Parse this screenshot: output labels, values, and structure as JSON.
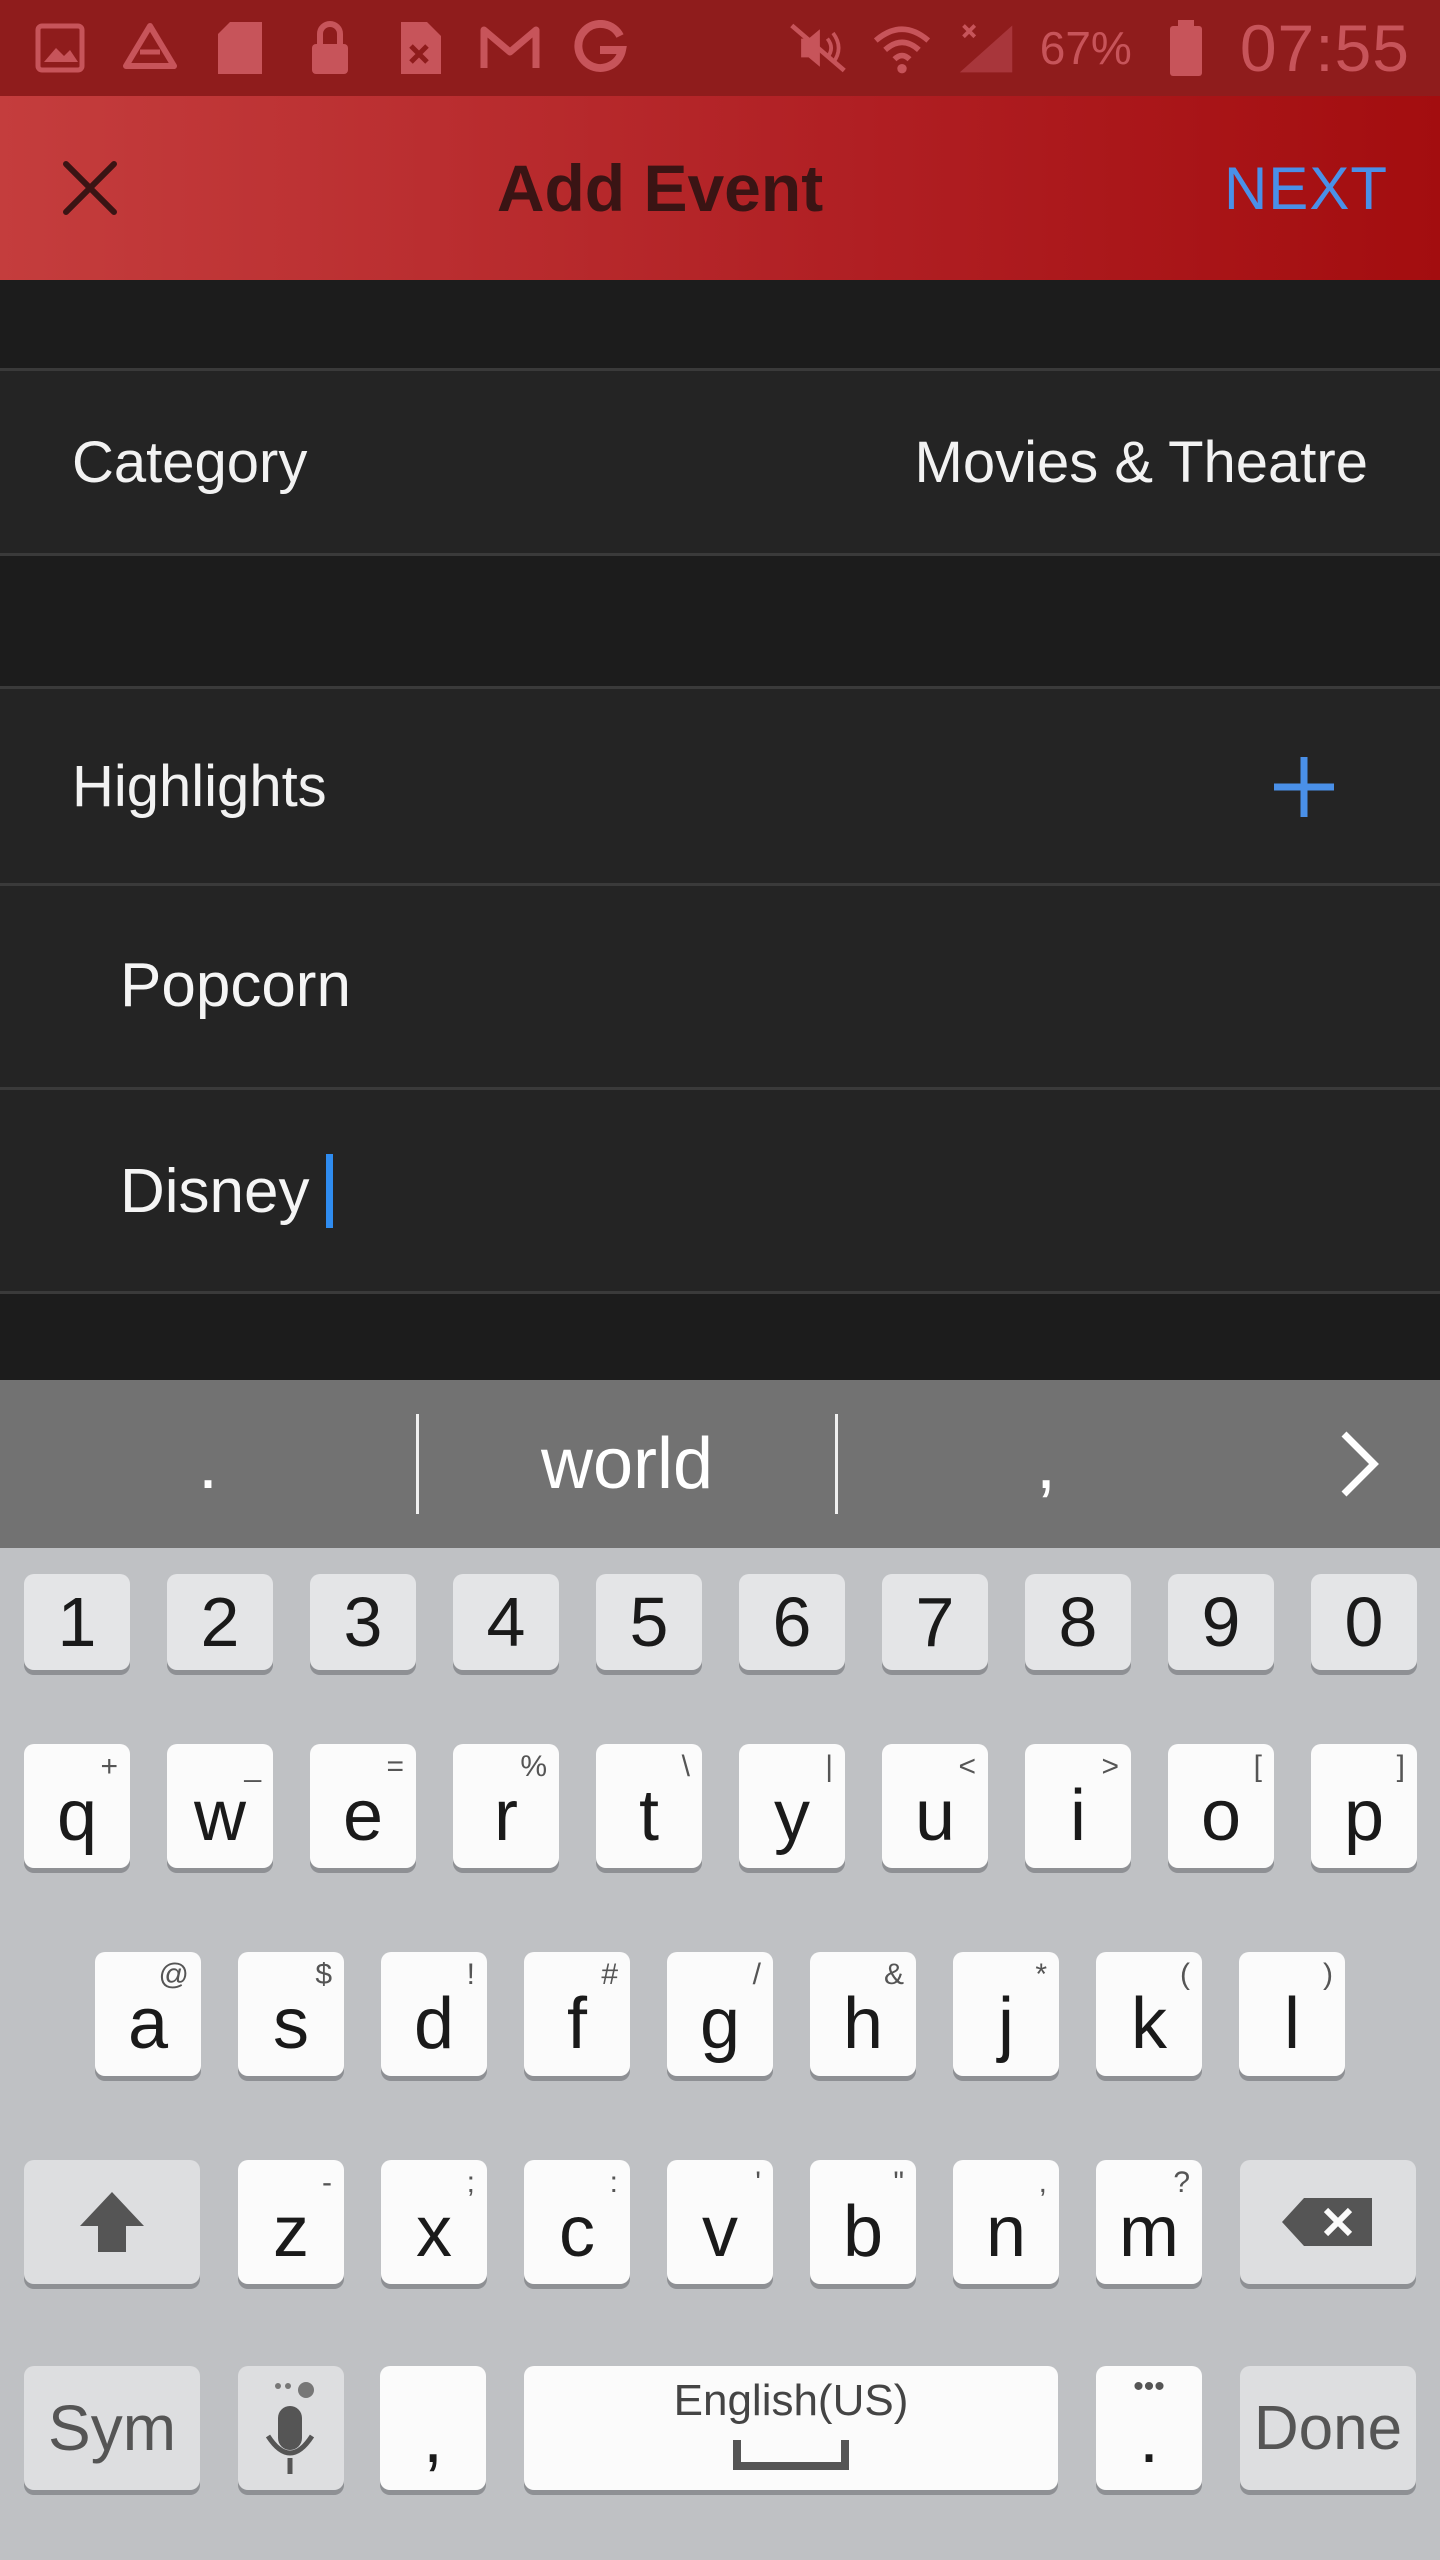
{
  "status_bar": {
    "battery_percent": "67%",
    "time": "07:55",
    "icons": [
      "gallery-icon",
      "drive-icon",
      "sd-card-icon",
      "lock-icon",
      "file-error-icon",
      "gmail-icon",
      "google-icon",
      "mute-icon",
      "wifi-icon",
      "signal-icon",
      "battery-icon"
    ]
  },
  "app_bar": {
    "title": "Add Event",
    "next_label": "NEXT"
  },
  "form": {
    "category_label": "Category",
    "category_value": "Movies & Theatre",
    "highlights_label": "Highlights",
    "highlights": [
      "Popcorn",
      "Disney"
    ]
  },
  "suggestions": {
    "left": ".",
    "center": "world",
    "right": ","
  },
  "keyboard": {
    "number_row": [
      "1",
      "2",
      "3",
      "4",
      "5",
      "6",
      "7",
      "8",
      "9",
      "0"
    ],
    "row1": [
      {
        "k": "q",
        "alt": "+"
      },
      {
        "k": "w",
        "alt": "_"
      },
      {
        "k": "e",
        "alt": "="
      },
      {
        "k": "r",
        "alt": "%"
      },
      {
        "k": "t",
        "alt": "\\"
      },
      {
        "k": "y",
        "alt": "|"
      },
      {
        "k": "u",
        "alt": "<"
      },
      {
        "k": "i",
        "alt": ">"
      },
      {
        "k": "o",
        "alt": "["
      },
      {
        "k": "p",
        "alt": "]"
      }
    ],
    "row2": [
      {
        "k": "a",
        "alt": "@"
      },
      {
        "k": "s",
        "alt": "$"
      },
      {
        "k": "d",
        "alt": "!"
      },
      {
        "k": "f",
        "alt": "#"
      },
      {
        "k": "g",
        "alt": "/"
      },
      {
        "k": "h",
        "alt": "&"
      },
      {
        "k": "j",
        "alt": "*"
      },
      {
        "k": "k",
        "alt": "("
      },
      {
        "k": "l",
        "alt": ")"
      }
    ],
    "row3": [
      {
        "k": "z",
        "alt": "-"
      },
      {
        "k": "x",
        "alt": ";"
      },
      {
        "k": "c",
        "alt": ":"
      },
      {
        "k": "v",
        "alt": "'"
      },
      {
        "k": "b",
        "alt": "\""
      },
      {
        "k": "n",
        "alt": ","
      },
      {
        "k": "m",
        "alt": "?"
      }
    ],
    "sym_label": "Sym",
    "comma": ",",
    "space_label": "English(US)",
    "period": ".",
    "done_label": "Done"
  },
  "colors": {
    "app_bar_red": "#b01f23",
    "accent_blue": "#4a90e8",
    "caret_blue": "#2f8cf0"
  }
}
